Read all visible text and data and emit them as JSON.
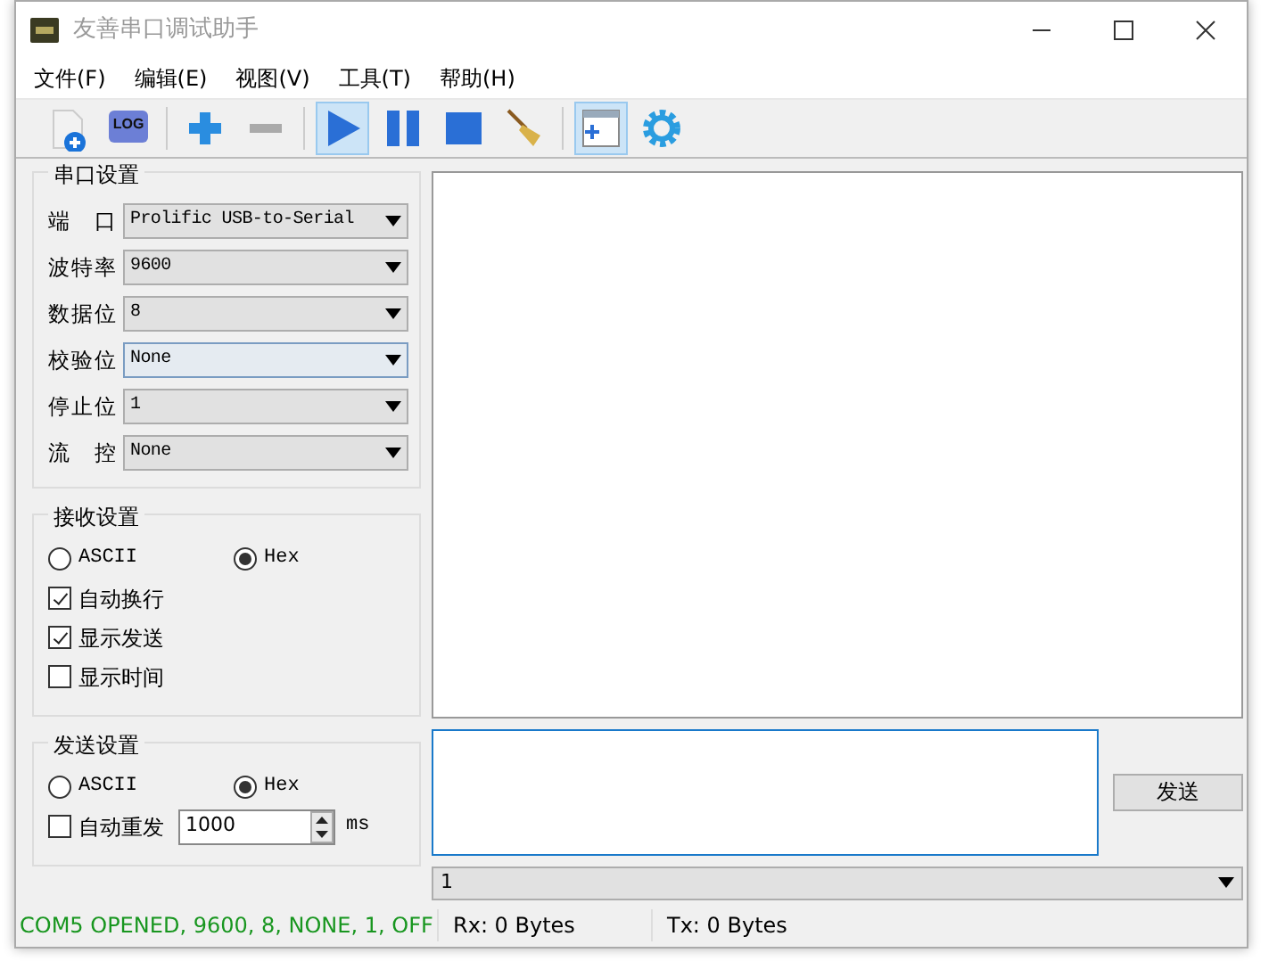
{
  "window": {
    "title": "友善串口调试助手"
  },
  "menu": [
    "文件(F)",
    "编辑(E)",
    "视图(V)",
    "工具(T)",
    "帮助(H)"
  ],
  "toolbar": [
    {
      "kind": "new",
      "selected": false
    },
    {
      "kind": "log",
      "selected": false,
      "label": "LOG"
    },
    {
      "kind": "plus",
      "selected": false
    },
    {
      "kind": "minus",
      "selected": false
    },
    {
      "kind": "play",
      "selected": true
    },
    {
      "kind": "pause",
      "selected": false
    },
    {
      "kind": "stop",
      "selected": false
    },
    {
      "kind": "broom",
      "selected": false
    },
    {
      "kind": "panel",
      "selected": true
    },
    {
      "kind": "gear",
      "selected": false
    }
  ],
  "serial_settings": {
    "title": "串口设置",
    "fields": [
      {
        "label": "端 口",
        "value": "Prolific USB-to-Serial",
        "focused": false
      },
      {
        "label": "波特率",
        "value": "9600",
        "focused": false
      },
      {
        "label": "数据位",
        "value": "8",
        "focused": false
      },
      {
        "label": "校验位",
        "value": "None",
        "focused": true
      },
      {
        "label": "停止位",
        "value": "1",
        "focused": false
      },
      {
        "label": "流 控",
        "value": "None",
        "focused": false
      }
    ]
  },
  "receive_settings": {
    "title": "接收设置",
    "modes": [
      {
        "label": "ASCII",
        "selected": false
      },
      {
        "label": "Hex",
        "selected": true
      }
    ],
    "options": [
      {
        "label": "自动换行",
        "checked": true
      },
      {
        "label": "显示发送",
        "checked": true
      },
      {
        "label": "显示时间",
        "checked": false
      }
    ]
  },
  "send_settings": {
    "title": "发送设置",
    "modes": [
      {
        "label": "ASCII",
        "selected": false
      },
      {
        "label": "Hex",
        "selected": true
      }
    ],
    "auto_resend": {
      "label": "自动重发",
      "checked": false,
      "value": "1000",
      "unit": "ms"
    }
  },
  "send_button": "发送",
  "history": {
    "value": "1"
  },
  "status_bar": [
    "COM5 OPENED, 9600, 8, NONE, 1, OFF",
    "Rx: 0 Bytes",
    "Tx: 0 Bytes"
  ]
}
